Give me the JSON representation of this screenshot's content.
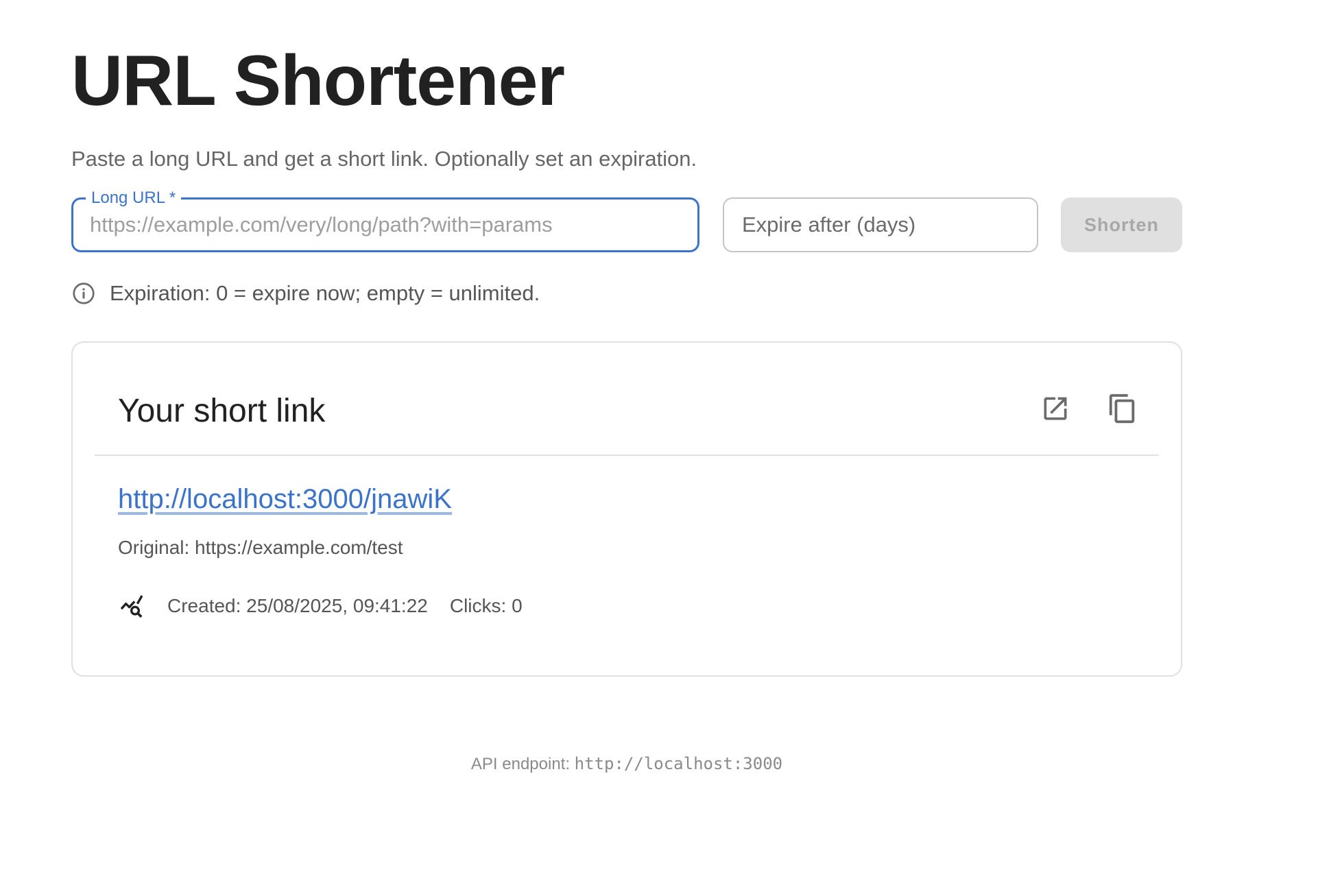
{
  "header": {
    "title": "URL Shortener",
    "subtitle": "Paste a long URL and get a short link. Optionally set an expiration."
  },
  "form": {
    "url_label": "Long URL",
    "url_required_mark": "*",
    "url_value": "",
    "url_placeholder": "https://example.com/very/long/path?with=params",
    "expire_value": "",
    "expire_placeholder": "Expire after (days)",
    "submit_label": "Shorten",
    "hint": "Expiration: 0 = expire now; empty = unlimited."
  },
  "result": {
    "title": "Your short link",
    "short_url": "http://localhost:3000/jnawiK",
    "original": "Original: https://example.com/test",
    "created": "Created: 25/08/2025, 09:41:22",
    "clicks": "Clicks: 0",
    "icons": {
      "open": "open-in-new-icon",
      "copy": "copy-icon",
      "stats": "query-stats-icon"
    }
  },
  "footer": {
    "label": "API endpoint:",
    "endpoint": "http://localhost:3000"
  },
  "colors": {
    "accent": "#3a73c9",
    "disabled_button_bg": "#e0e0e0",
    "disabled_button_text": "#a8a8a8",
    "text_primary": "#212121",
    "text_secondary": "#555555"
  }
}
